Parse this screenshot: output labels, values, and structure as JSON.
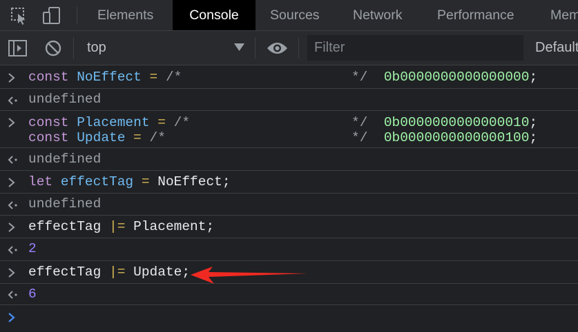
{
  "tabs": [
    {
      "label": "Elements",
      "active": false
    },
    {
      "label": "Console",
      "active": true
    },
    {
      "label": "Sources",
      "active": false
    },
    {
      "label": "Network",
      "active": false
    },
    {
      "label": "Performance",
      "active": false
    },
    {
      "label": "Mem",
      "active": false
    }
  ],
  "toolbar": {
    "context": "top",
    "filter_placeholder": "Filter",
    "levels_label": "Default"
  },
  "console": {
    "entries": [
      {
        "input": [
          {
            "keyword": "const",
            "name": "NoEffect",
            "op": "=",
            "comment_open": "/*",
            "comment_close": "*/",
            "value": "0b0000000000000000",
            "end": ";"
          }
        ],
        "output": "undefined"
      },
      {
        "input": [
          {
            "keyword": "const",
            "name": "Placement",
            "op": "=",
            "comment_open": "/*",
            "comment_close": "*/",
            "value": "0b0000000000000010",
            "end": ";"
          },
          {
            "keyword": "const",
            "name": "Update",
            "op": "=",
            "comment_open": "/*",
            "comment_close": "*/",
            "value": "0b0000000000000100",
            "end": ";"
          }
        ],
        "output": "undefined"
      },
      {
        "input": [
          {
            "keyword": "let",
            "name": "effectTag",
            "op": "=",
            "rhs": "NoEffect;"
          }
        ],
        "output": "undefined"
      },
      {
        "input": [
          {
            "lhs": "effectTag",
            "op": "|=",
            "rhs": "Placement;"
          }
        ],
        "output": "2"
      },
      {
        "input": [
          {
            "lhs": "effectTag",
            "op": "|=",
            "rhs": "Update;"
          }
        ],
        "output": "6"
      }
    ]
  },
  "colors": {
    "background": "#202124",
    "toolbar": "#292a2d",
    "keyword": "#c397d8",
    "variable": "#6fbbf2",
    "operator": "#d7b855",
    "binary_literal": "#9ff3a8",
    "number_result": "#9980ff",
    "prompt_blue": "#4a8df8",
    "annotation_arrow": "#f02a22"
  },
  "icons": [
    "inspect-element-icon",
    "device-toolbar-icon",
    "sidebar-toggle-icon",
    "clear-console-icon",
    "dropdown-arrow-icon",
    "eye-icon",
    "prompt-chevron-icon",
    "result-arrow-icon",
    "red-arrow-annotation"
  ]
}
